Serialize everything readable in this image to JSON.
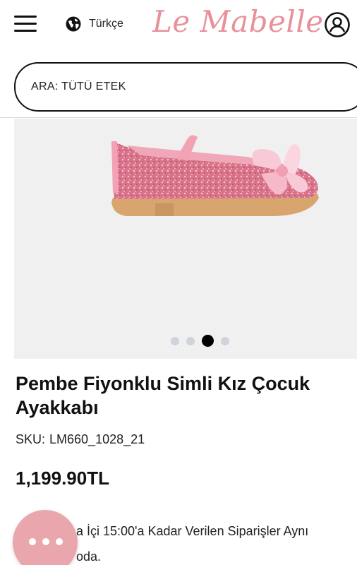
{
  "header": {
    "menu_icon": "hamburger-menu-icon",
    "language_icon": "globe-icon",
    "language_label": "Türkçe",
    "logo_text": "Le Mabelle",
    "account_icon": "user-account-icon"
  },
  "search": {
    "placeholder": "ARA: TÜTÜ ETEK"
  },
  "gallery": {
    "image_alt": "pink-glitter-shoe",
    "dot_count": 4,
    "active_dot_index": 2
  },
  "product": {
    "title": "Pembe Fiyonklu Simli Kız Çocuk Ayakkabı",
    "sku_label": "SKU:",
    "sku_value": "LM660_1028_21",
    "price": "1,199.90TL"
  },
  "notice": {
    "line1": "a İçi 15:00'a Kadar Verilen Siparişler Aynı",
    "line2": "oda."
  },
  "chat": {
    "icon": "chat-dots-icon"
  },
  "colors": {
    "brand_pink": "#e8919a",
    "chat_pink": "#e9a6ac",
    "gallery_bg": "#f0f0f0"
  }
}
